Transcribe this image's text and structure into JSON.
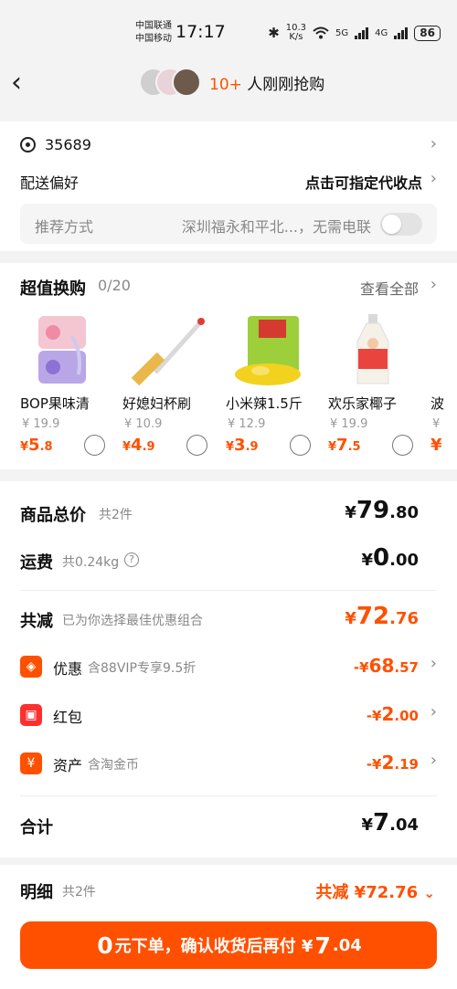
{
  "status_bar": {
    "carrier1": "中国联通",
    "carrier2": "中国移动",
    "time": "17:17",
    "speed_value": "10.3",
    "speed_unit": "K/s",
    "network1": "5G",
    "network2": "4G",
    "battery": "86"
  },
  "header": {
    "buyers_count": "10+",
    "buyers_text": " 人刚刚抢购"
  },
  "address": {
    "code": "35689",
    "delivery_pref_label": "配送偏好",
    "delivery_pref_action": "点击可指定代收点",
    "recommend_label": "推荐方式",
    "recommend_desc": "深圳福永和平北...，无需电联"
  },
  "deals": {
    "title": "超值换购",
    "count": "0/20",
    "view_all": "查看全部",
    "items": [
      {
        "name": "BOP果味清",
        "orig": "¥ 19.9",
        "cur": "¥",
        "int": "5",
        "dec": ".8",
        "icon": "mint-box-icon"
      },
      {
        "name": "好媳妇杯刷",
        "orig": "¥ 10.9",
        "cur": "¥",
        "int": "4",
        "dec": ".9",
        "icon": "cup-brush-icon"
      },
      {
        "name": "小米辣1.5斤",
        "orig": "¥ 12.9",
        "cur": "¥",
        "int": "3",
        "dec": ".9",
        "icon": "chili-pack-icon"
      },
      {
        "name": "欢乐家椰子",
        "orig": "¥ 19.9",
        "cur": "¥",
        "int": "7",
        "dec": ".5",
        "icon": "coconut-drink-icon"
      },
      {
        "name": "波",
        "orig": "¥",
        "cur": "¥",
        "int": "",
        "dec": "",
        "icon": "partial-product-icon"
      }
    ]
  },
  "summary": {
    "goods_label": "商品总价",
    "goods_count": "共2件",
    "goods_cur": "¥",
    "goods_int": "79",
    "goods_dec": ".80",
    "shipping_label": "运费",
    "shipping_weight": "共0.24kg",
    "shipping_cur": "¥",
    "shipping_int": "0",
    "shipping_dec": ".00",
    "reduce_label": "共减",
    "reduce_note": "已为你选择最佳优惠组合",
    "reduce_cur": "¥",
    "reduce_int": "72",
    "reduce_dec": ".76",
    "promos": [
      {
        "label": "优惠",
        "note": "含88VIP专享9.5折",
        "sign": "-¥",
        "int": "68",
        "dec": ".57",
        "icon": "tag-icon",
        "color": "#ff5000"
      },
      {
        "label": "红包",
        "note": "",
        "sign": "-¥",
        "int": "2",
        "dec": ".00",
        "icon": "red-envelope-icon",
        "color": "#ff2f2f"
      },
      {
        "label": "资产",
        "note": "含淘金币",
        "sign": "-¥",
        "int": "2",
        "dec": ".19",
        "icon": "yuan-coin-icon",
        "color": "#ff5000"
      }
    ],
    "total_label": "合计",
    "total_cur": "¥",
    "total_int": "7",
    "total_dec": ".04"
  },
  "footer": {
    "detail_label": "明细",
    "detail_count": "共2件",
    "detail_save": "共减 ¥72.76",
    "cta_zero": "0",
    "cta_text": "元下单，确认收货后再付 ¥",
    "cta_int": "7",
    "cta_dec": ".04"
  },
  "colors": {
    "accent": "#ff5000",
    "red_packet": "#ff2f2f",
    "background": "#f3f3f3"
  }
}
